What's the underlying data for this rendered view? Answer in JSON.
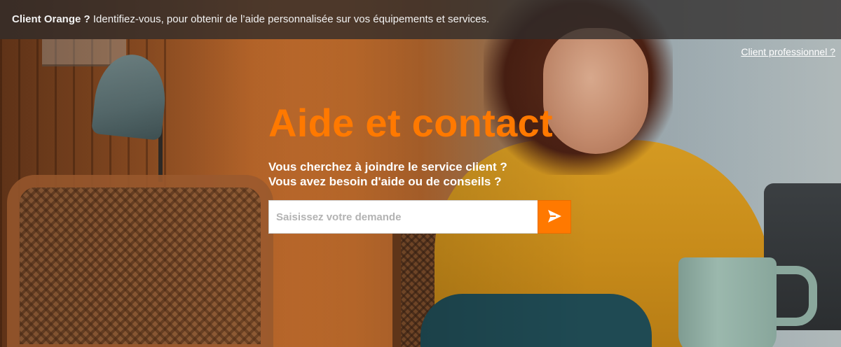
{
  "banner": {
    "bold_text": "Client Orange ?",
    "text": " Identifiez-vous, pour obtenir de l’aide personnalisée sur vos équipements et services."
  },
  "pro_link": {
    "label": "Client professionnel ?"
  },
  "hero": {
    "title": "Aide et contact",
    "subtitle_line1": "Vous cherchez à joindre le service client ?",
    "subtitle_line2": "Vous avez besoin d'aide ou de conseils ?"
  },
  "search": {
    "placeholder": "Saisissez votre demande",
    "value": "",
    "submit_icon": "send-arrow-icon"
  },
  "colors": {
    "accent": "#ff7900",
    "banner_bg": "#302c2a",
    "text_light": "#ffffff"
  }
}
